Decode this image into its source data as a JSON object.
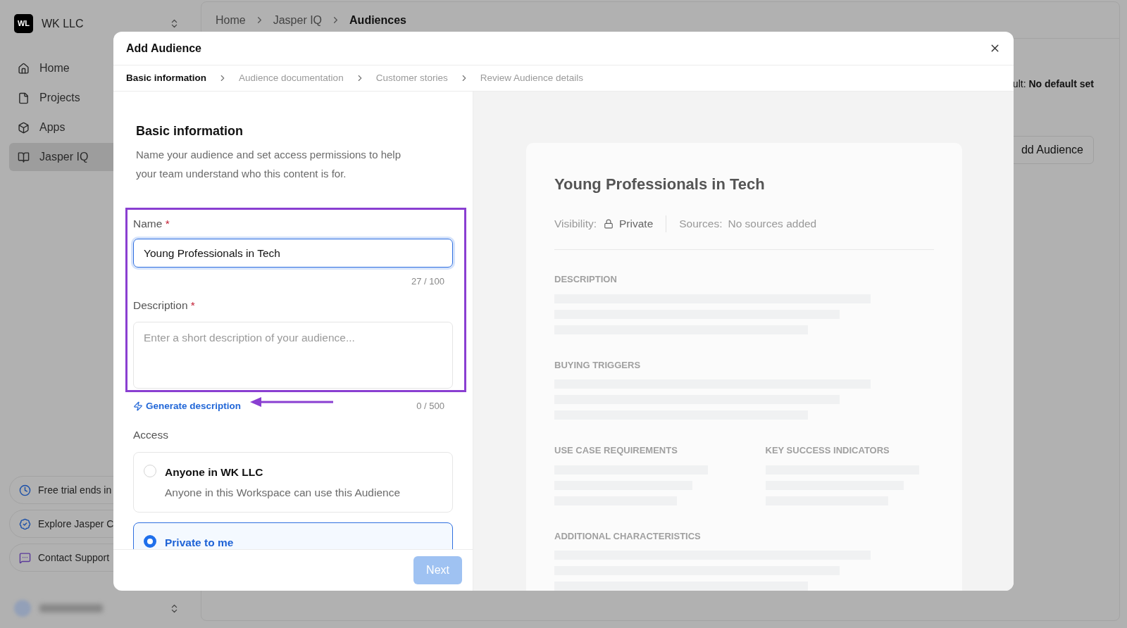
{
  "sidebar": {
    "workspace": {
      "initials": "WL",
      "name": "WK LLC"
    },
    "nav": [
      {
        "label": "Home",
        "selected": false
      },
      {
        "label": "Projects",
        "selected": false
      },
      {
        "label": "Apps",
        "selected": false
      },
      {
        "label": "Jasper IQ",
        "selected": true
      }
    ],
    "promos": [
      {
        "kind": "trial",
        "label": "Free trial ends in"
      },
      {
        "kind": "explore",
        "label": "Explore Jasper C"
      },
      {
        "kind": "support",
        "label": "Contact Support"
      }
    ]
  },
  "breadcrumbs": [
    {
      "label": "Home",
      "current": false
    },
    {
      "label": "Jasper IQ",
      "current": false
    },
    {
      "label": "Audiences",
      "current": true
    }
  ],
  "background": {
    "default_label": "ult:",
    "default_value": "No default set",
    "add_button": "dd Audience"
  },
  "modal": {
    "title": "Add Audience",
    "steps": [
      {
        "label": "Basic information",
        "selected": true
      },
      {
        "label": "Audience documentation",
        "selected": false
      },
      {
        "label": "Customer stories",
        "selected": false
      },
      {
        "label": "Review Audience details",
        "selected": false
      }
    ],
    "section_title": "Basic information",
    "section_text": "Name your audience and set access permissions to help your team understand who this content is for.",
    "name_field": {
      "label": "Name",
      "required_mark": "*",
      "value": "Young Professionals in Tech",
      "counter": "27 / 100"
    },
    "description_field": {
      "label": "Description",
      "required_mark": "*",
      "placeholder": "Enter a short description of your audience...",
      "counter": "0 / 500"
    },
    "generate_link": "Generate description",
    "access": {
      "label": "Access",
      "options": [
        {
          "title": "Anyone in WK LLC",
          "text": "Anyone in this Workspace can use this Audience",
          "selected": false
        },
        {
          "title": "Private to me",
          "selected": true
        }
      ]
    },
    "next_button": {
      "label": "Next",
      "disabled": true
    }
  },
  "preview": {
    "title": "Young Professionals in Tech",
    "visibility_label": "Visibility:",
    "visibility_value": "Private",
    "sources_label": "Sources:",
    "sources_value": "No sources added",
    "sections": [
      {
        "heading": "DESCRIPTION",
        "kind": "full"
      },
      {
        "heading": "BUYING TRIGGERS",
        "kind": "full"
      },
      {
        "heading": "USE CASE REQUIREMENTS",
        "kind": "half"
      },
      {
        "heading": "KEY SUCCESS INDICATORS",
        "kind": "half"
      },
      {
        "heading": "ADDITIONAL CHARACTERISTICS",
        "kind": "full"
      }
    ]
  }
}
